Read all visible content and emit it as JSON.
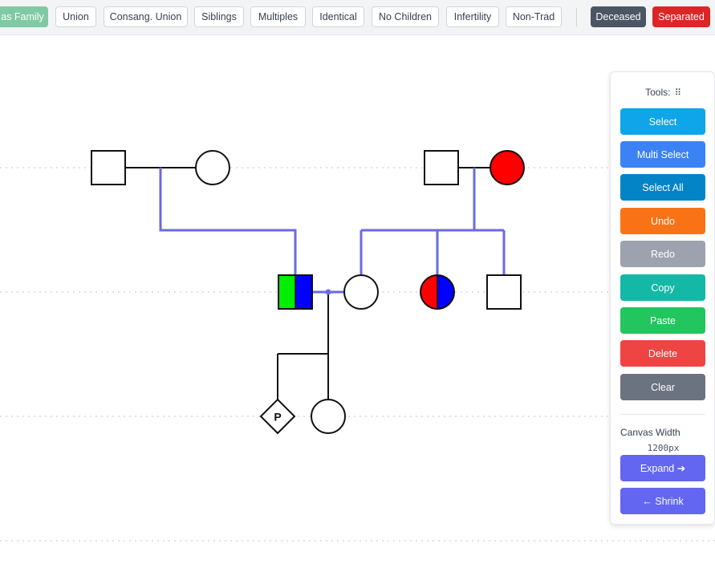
{
  "toolbar": {
    "buttons": [
      {
        "label": "as Family"
      },
      {
        "label": "Union"
      },
      {
        "label": "Consang. Union"
      },
      {
        "label": "Siblings"
      },
      {
        "label": "Multiples"
      },
      {
        "label": "Identical"
      },
      {
        "label": "No Children"
      },
      {
        "label": "Infertility"
      },
      {
        "label": "Non-Trad"
      }
    ],
    "deceased_label": "Deceased",
    "separated_label": "Separated"
  },
  "canvas": {
    "symbols": {
      "diamond_label": "P"
    }
  },
  "tools": {
    "title": "Tools:",
    "drag_handle_icon": "grip-dots-icon",
    "buttons": [
      {
        "label": "Select",
        "color": "#0ea5e9"
      },
      {
        "label": "Multi Select",
        "color": "#3b82f6"
      },
      {
        "label": "Select All",
        "color": "#0284c7"
      },
      {
        "label": "Undo",
        "color": "#f97316"
      },
      {
        "label": "Redo",
        "color": "#9ca3af"
      },
      {
        "label": "Copy",
        "color": "#14b8a6"
      },
      {
        "label": "Paste",
        "color": "#22c55e"
      },
      {
        "label": "Delete",
        "color": "#ef4444"
      },
      {
        "label": "Clear",
        "color": "#6b7280"
      }
    ],
    "canvas_width_label": "Canvas Width",
    "canvas_width_value": "1200px",
    "expand_label": "Expand ➔",
    "shrink_label": "← Shrink",
    "expand_color": "#6366f1",
    "shrink_color": "#6366f1"
  },
  "colors": {
    "link_line": "#6a6ae0",
    "affected_red": "#ff0000",
    "affected_blue": "#0000ff",
    "affected_green": "#00ee00"
  }
}
